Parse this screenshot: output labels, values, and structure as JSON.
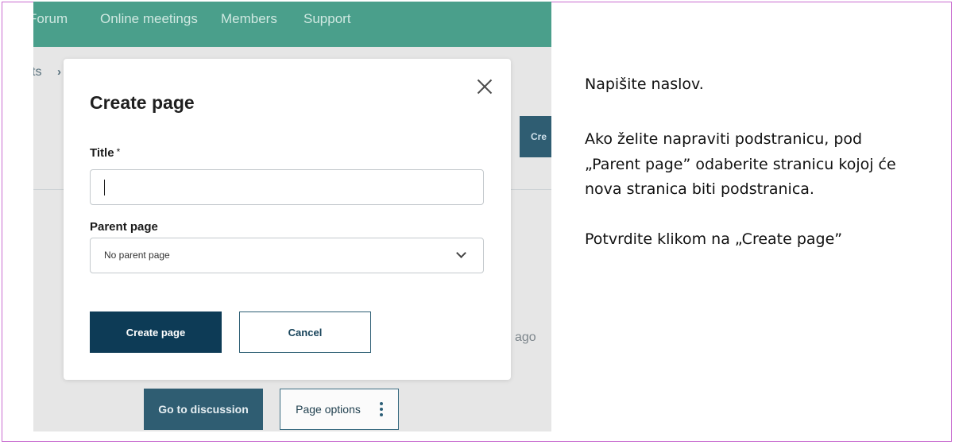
{
  "nav": {
    "items": [
      "Forum",
      "Online meetings",
      "Members",
      "Support"
    ]
  },
  "background": {
    "breadcrumb_fragment": "ts",
    "breadcrumb_separator": "›",
    "create_button_fragment": "Cre",
    "time_fragment": "ago",
    "go_to_discussion": "Go to discussion",
    "page_options": "Page options"
  },
  "modal": {
    "title": "Create page",
    "title_label": "Title",
    "required_mark": "*",
    "title_value": "",
    "parent_label": "Parent page",
    "parent_value": "No parent page",
    "create_button": "Create page",
    "cancel_button": "Cancel"
  },
  "instructions": {
    "p1": "Napišite naslov.",
    "p2_line1": "Ako želite napraviti podstranicu, pod",
    "p2_line2": "„Parent page” odaberite stranicu kojoj će",
    "p2_line3": "nova stranica biti podstranica.",
    "p3": "Potvrdite klikom na „Create page”"
  },
  "colors": {
    "nav": "#4a9f8b",
    "primary": "#0d3b56",
    "secondary_button": "#2f5d72",
    "frame_border": "#c86bd0"
  }
}
